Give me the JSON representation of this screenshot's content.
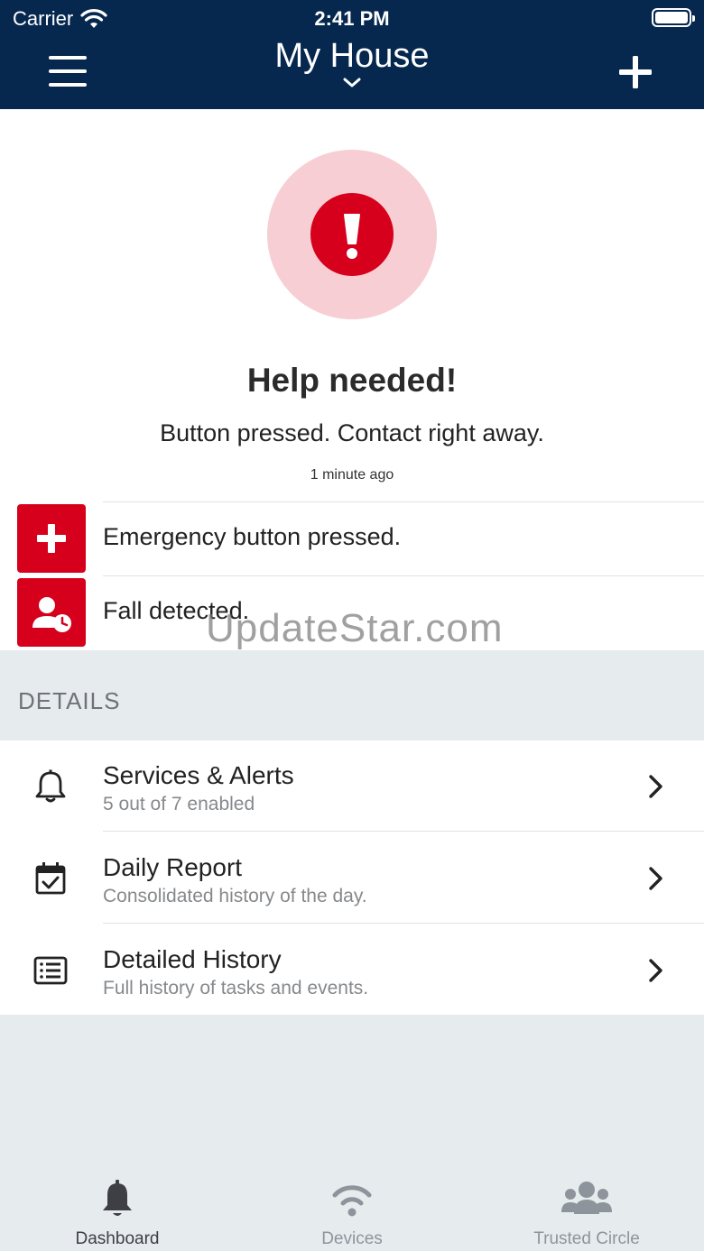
{
  "status_bar": {
    "carrier": "Carrier",
    "time": "2:41 PM"
  },
  "header": {
    "title": "My House"
  },
  "alert": {
    "title": "Help needed!",
    "subtitle": "Button pressed. Contact right away.",
    "time": "1 minute ago"
  },
  "events": [
    {
      "label": "Emergency button pressed.",
      "icon": "medical-plus-icon"
    },
    {
      "label": "Fall detected.",
      "icon": "person-clock-icon"
    }
  ],
  "details": {
    "section_label": "DETAILS",
    "items": [
      {
        "title": "Services & Alerts",
        "subtitle": "5 out of 7 enabled",
        "icon": "bell-icon"
      },
      {
        "title": "Daily Report",
        "subtitle": "Consolidated history of the day.",
        "icon": "calendar-check-icon"
      },
      {
        "title": "Detailed History",
        "subtitle": "Full history of tasks and events.",
        "icon": "list-icon"
      }
    ]
  },
  "watermark": "UpdateStar.com",
  "tabs": [
    {
      "label": "Dashboard",
      "icon": "bell-icon",
      "active": true
    },
    {
      "label": "Devices",
      "icon": "wifi-icon",
      "active": false
    },
    {
      "label": "Trusted Circle",
      "icon": "group-icon",
      "active": false
    }
  ],
  "colors": {
    "header_bg": "#06284f",
    "alert_red": "#d6001c",
    "alert_halo": "#f7ced4",
    "section_bg": "#e6ebee"
  }
}
